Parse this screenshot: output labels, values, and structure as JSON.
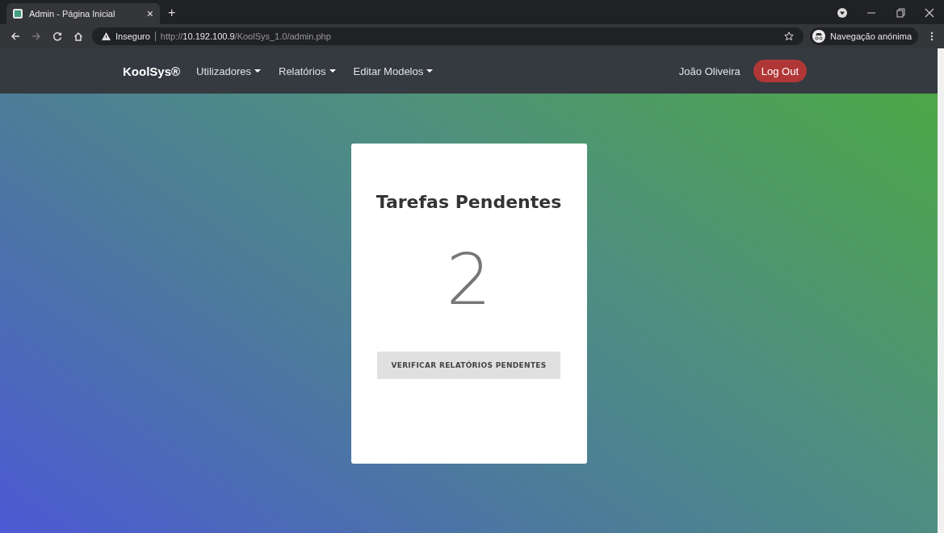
{
  "browser": {
    "tab": {
      "title": "Admin - Página Inicial",
      "close": "×",
      "selected": true
    },
    "new_tab": "+",
    "security": "Inseguro",
    "url_scheme": "http://",
    "url_host": "10.192.100.9",
    "url_path": "/KoolSys_1.0/admin.php",
    "profile": "Navegação anónima"
  },
  "navbar": {
    "brand": "KoolSys®",
    "menus": [
      {
        "label": "Utilizadores"
      },
      {
        "label": "Relatórios"
      },
      {
        "label": "Editar Modelos"
      }
    ],
    "user": "João Oliveira",
    "logout": "Log Out"
  },
  "card": {
    "title": "Tarefas Pendentes",
    "count": "2",
    "button": "VERIFICAR RELATÓRIOS PENDENTES"
  }
}
